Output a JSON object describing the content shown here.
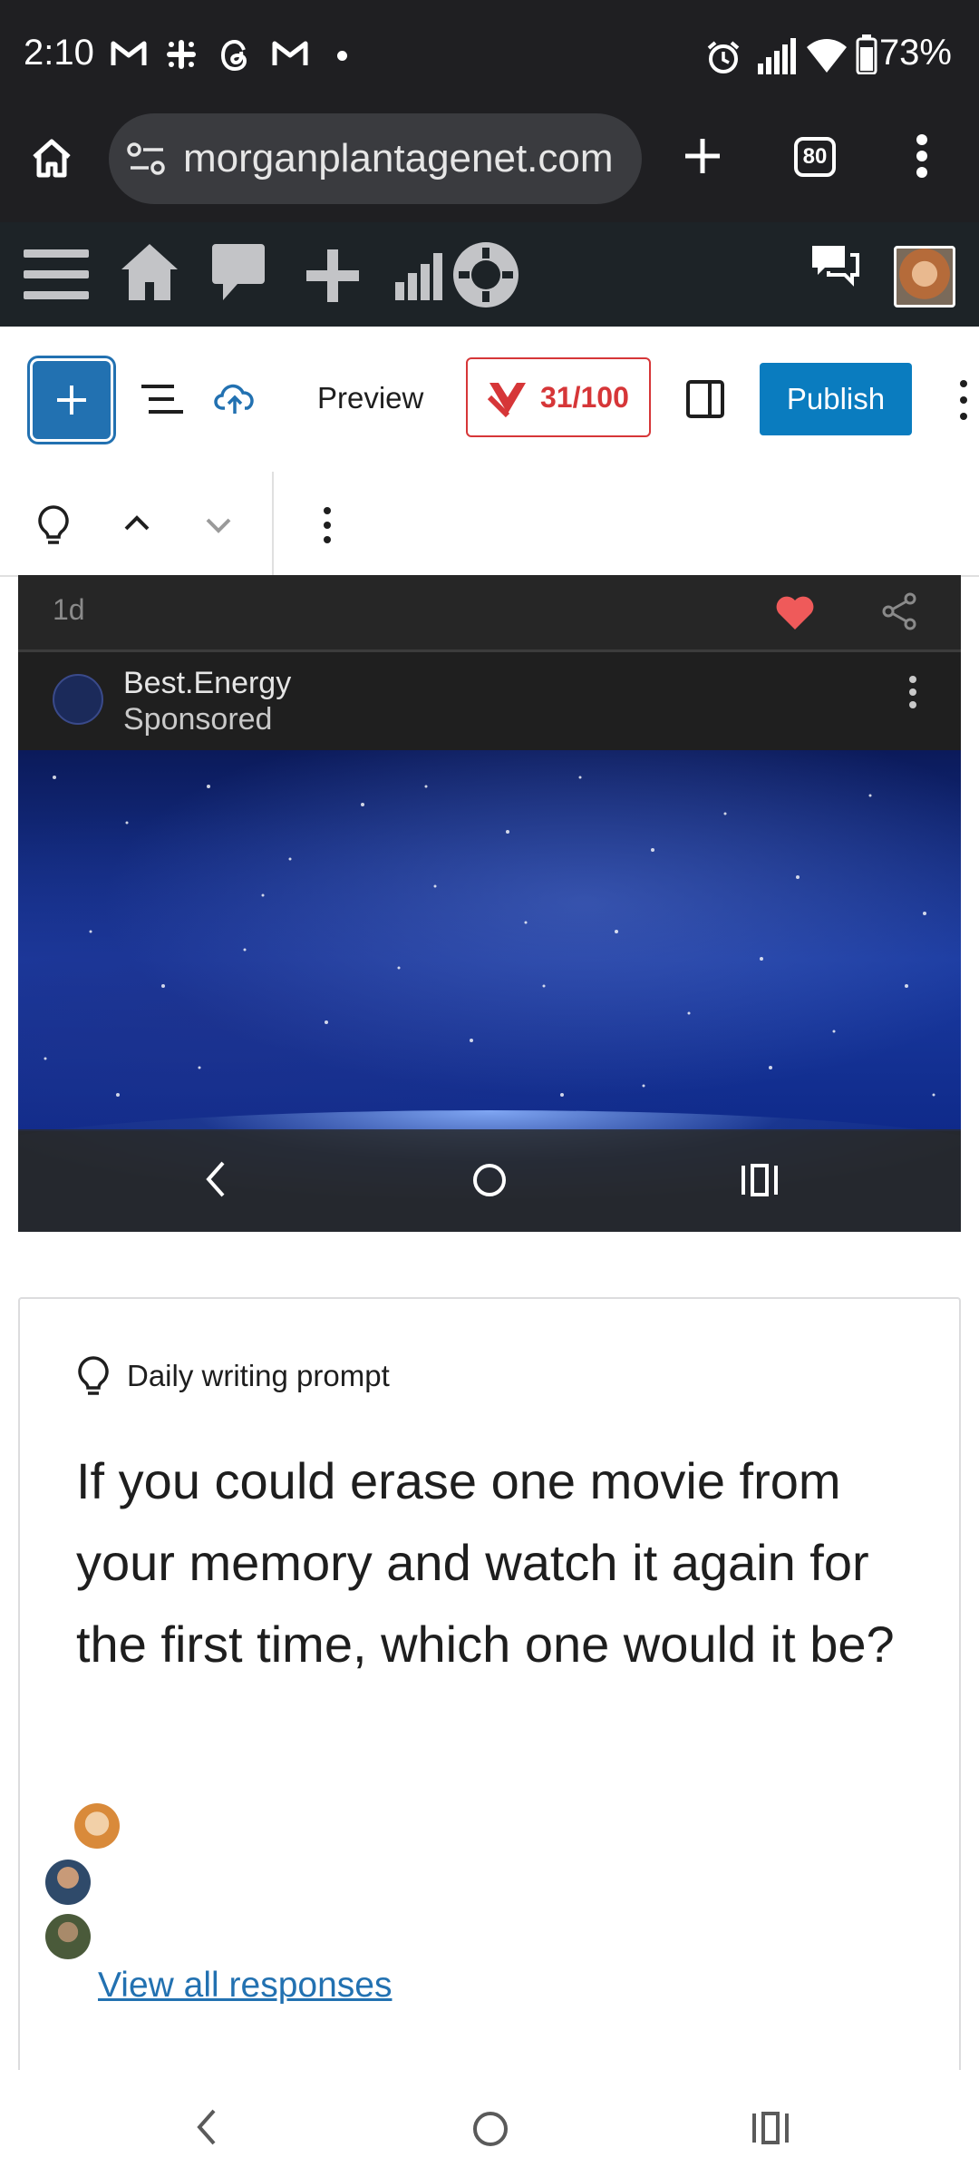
{
  "status_bar": {
    "time": "2:10",
    "battery": "73%",
    "notification_icons": [
      "gmail-icon",
      "slack-icon",
      "threads-icon",
      "gmail-icon",
      "dot-icon"
    ],
    "system_icons": [
      "alarm-icon",
      "signal-icon",
      "wifi-icon",
      "battery-icon"
    ]
  },
  "browser": {
    "url": "morganplantagenet.com",
    "tab_count": "80"
  },
  "wp_admin_bar": {
    "items": [
      "menu-icon",
      "home-icon",
      "comment-icon",
      "plus-icon",
      "stats-icon",
      "jetpack-icon",
      "notifications-icon",
      "avatar"
    ]
  },
  "editor_toolbar": {
    "preview_label": "Preview",
    "seo_score": "31/100",
    "publish_label": "Publish"
  },
  "embedded_image": {
    "time_ago": "1d",
    "sponsor_name": "Best.Energy",
    "sponsor_tag": "Sponsored"
  },
  "prompt_card": {
    "label": "Daily writing prompt",
    "question": "If you could erase one movie from your memory and watch it again for the first time, which one would it be?",
    "view_all": "View all responses"
  },
  "colors": {
    "wp_blue": "#2271b1",
    "publish_blue": "#0a7cbf",
    "seo_red": "#d63638",
    "dark_bar": "#1f1f22"
  }
}
